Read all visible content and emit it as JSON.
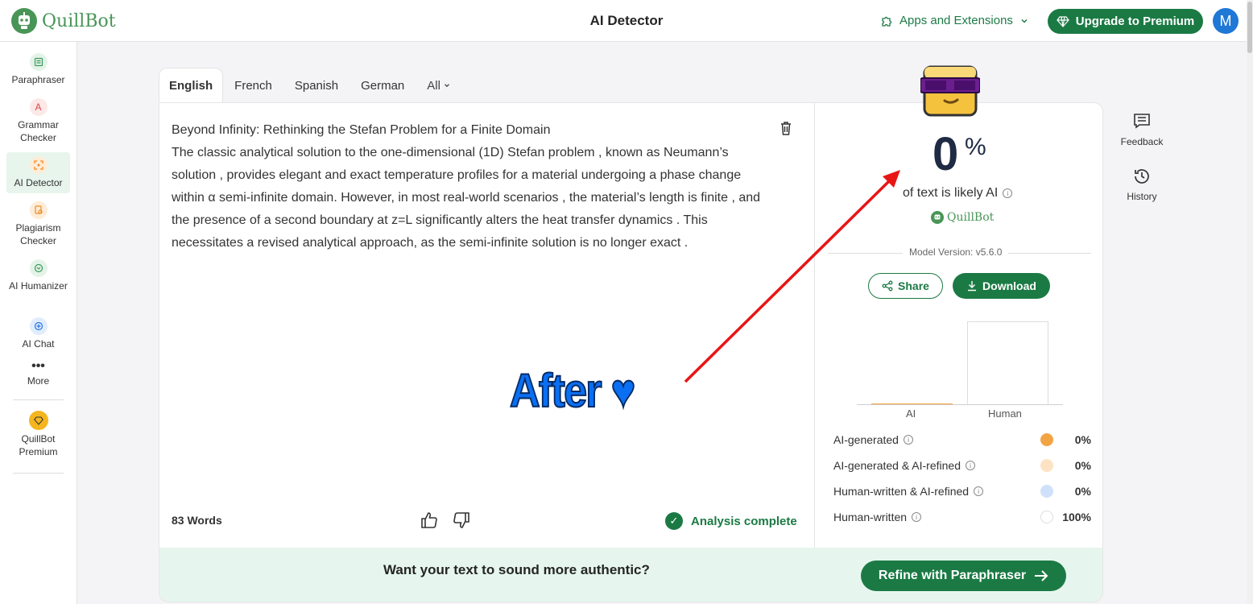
{
  "header": {
    "brand": "QuillBot",
    "title": "AI Detector",
    "apps_label": "Apps and Extensions",
    "upgrade_label": "Upgrade to Premium",
    "avatar_initial": "M"
  },
  "sidebar": {
    "items": [
      {
        "label": "Paraphraser",
        "icon": "paraphraser-icon"
      },
      {
        "label": "Grammar Checker",
        "icon": "grammar-icon"
      },
      {
        "label": "AI Detector",
        "icon": "ai-detector-icon"
      },
      {
        "label": "Plagiarism Checker",
        "icon": "plagiarism-icon"
      },
      {
        "label": "AI Humanizer",
        "icon": "humanizer-icon"
      },
      {
        "label": "AI Chat",
        "icon": "chat-icon"
      },
      {
        "label": "More",
        "icon": "more-icon"
      },
      {
        "label": "QuillBot Premium",
        "icon": "premium-icon"
      }
    ]
  },
  "tabs": [
    "English",
    "French",
    "Spanish",
    "German",
    "All"
  ],
  "editor": {
    "title_line": "Beyond Infinity: Rethinking the Stefan Problem for a Finite Domain",
    "body": "The classic analytical solution to the one-dimensional (1D) Stefan problem , known as Neumann’s solution , provides elegant and exact temperature profiles for a material undergoing a phase change within α semi-infinite domain. However, in most real-world scenarios , the material’s length is finite , and the presence of a second boundary at z=L significantly alters the heat transfer dynamics . This necessitates a revised analytical approach, as the semi-infinite solution is no longer exact .",
    "word_count": "83 Words",
    "status": "Analysis complete"
  },
  "result": {
    "percent": "0",
    "percent_sign": "%",
    "likely_text": "of text is likely AI",
    "brand": "QuillBot",
    "model_version": "Model Version: v5.6.0",
    "share_label": "Share",
    "download_label": "Download",
    "chart_labels": [
      "AI",
      "Human"
    ],
    "legend": [
      {
        "label": "AI-generated",
        "value": "0%",
        "color": "#f2a444"
      },
      {
        "label": "AI-generated & AI-refined",
        "value": "0%",
        "color": "#fde3c4"
      },
      {
        "label": "Human-written & AI-refined",
        "value": "0%",
        "color": "#cfe0fb"
      },
      {
        "label": "Human-written",
        "value": "100%",
        "color": "#ffffff"
      }
    ]
  },
  "promo": {
    "text": "Want your text to sound more authentic?",
    "button": "Refine with Paraphraser"
  },
  "rail": {
    "feedback": "Feedback",
    "history": "History"
  },
  "overlay": {
    "after_text": "After",
    "heart": "♥"
  }
}
